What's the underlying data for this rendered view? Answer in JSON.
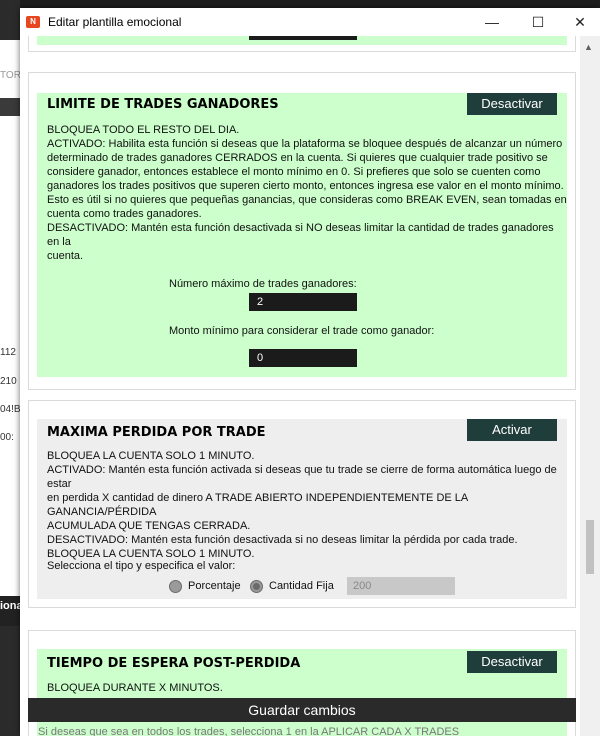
{
  "background": {
    "texts": [
      "TOR",
      "112",
      "210",
      "04!B",
      "00:",
      "iona"
    ]
  },
  "window": {
    "title": "Editar plantilla emocional",
    "minimize": "—",
    "maximize": "☐",
    "close": "✕"
  },
  "cards": {
    "limite_ganadores": {
      "title": "LIMITE DE TRADES GANADORES",
      "button": "Desactivar",
      "description": "BLOQUEA TODO EL RESTO DEL DIA.\nACTIVADO: Habilita esta función si deseas que la plataforma se bloquee después de alcanzar un número\ndeterminado de trades ganadores CERRADOS en la cuenta. Si quieres que cualquier trade positivo se\nconsidere ganador, entonces establece el monto mínimo en 0. Si prefieres que solo se cuenten como\nganadores los trades positivos que superen cierto monto, entonces ingresa ese valor en el monto mínimo.\nEsto es útil si no quieres que pequeñas ganancias, que consideras como BREAK EVEN, sean tomadas en\ncuenta como trades ganadores.\nDESACTIVADO: Mantén esta función desactivada si NO deseas limitar la cantidad de trades ganadores en la\ncuenta.",
      "max_label": "Número máximo de trades ganadores:",
      "max_value": "2",
      "min_label": "Monto mínimo para considerar el trade como ganador:",
      "min_value": "0"
    },
    "maxima_perdida": {
      "title": "MAXIMA PERDIDA POR TRADE",
      "button": "Activar",
      "description": "BLOQUEA LA CUENTA SOLO 1 MINUTO.\nACTIVADO: Mantén esta función activada si deseas que tu trade se cierre de forma automática luego de estar\nen perdida X cantidad de dinero A TRADE ABIERTO INDEPENDIENTEMENTE DE LA GANANCIA/PÉRDIDA\nACUMULADA QUE TENGAS CERRADA.\nDESACTIVADO: Mantén esta función desactivada si no deseas limitar la pérdida por cada trade.\nBLOQUEA LA CUENTA SOLO 1 MINUTO.",
      "select_label": "Selecciona el tipo y especifica el valor:",
      "option_percent": "Porcentaje",
      "option_fixed": "Cantidad Fija",
      "selected": "Cantidad Fija",
      "value": "200"
    },
    "tiempo_espera": {
      "title": "TIEMPO DE ESPERA POST-PERDIDA",
      "button": "Desactivar",
      "description": "BLOQUEA DURANTE X MINUTOS."
    }
  },
  "save_button": "Guardar cambios",
  "below_text": "Si deseas que sea en todos los trades, selecciona 1 en la APLICAR CADA X TRADES",
  "colors": {
    "active_green": "#ccffcc",
    "inactive_gray": "#eeeeee",
    "button_bg": "#1f3d3a",
    "save_bar": "#2a2a2a"
  },
  "icons": {
    "app": "app-logo-icon",
    "scroll_up": "chevron-up-icon"
  }
}
